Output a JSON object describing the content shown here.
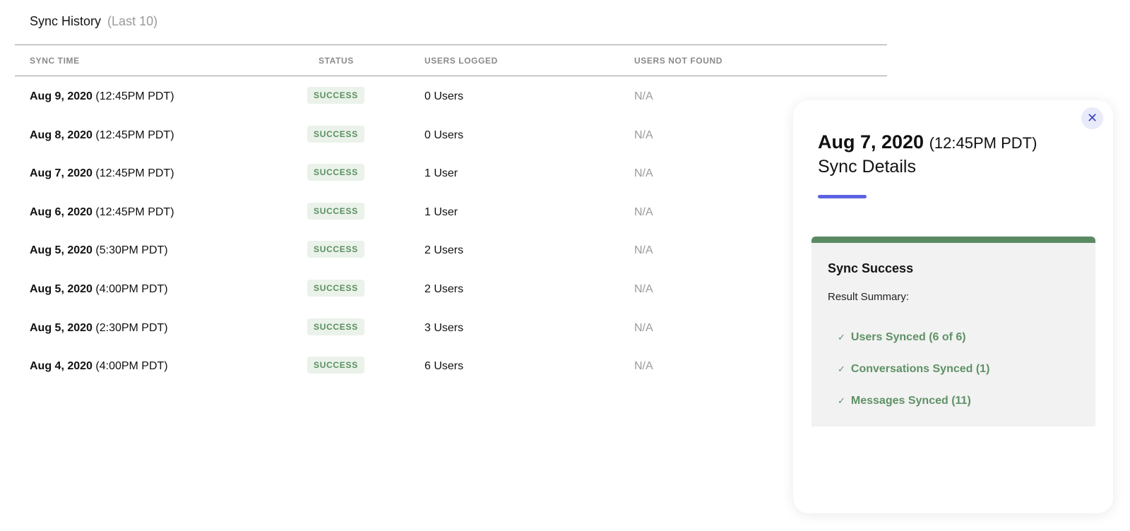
{
  "history": {
    "title": "Sync History",
    "subtitle": "(Last 10)",
    "columns": {
      "sync_time": "SYNC TIME",
      "status": "STATUS",
      "users_logged": "USERS LOGGED",
      "users_not_found": "USERS NOT FOUND"
    },
    "rows": [
      {
        "date": "Aug 9, 2020",
        "time": "(12:45PM PDT)",
        "status": "SUCCESS",
        "logged": "0 Users",
        "not_found": "N/A"
      },
      {
        "date": "Aug 8, 2020",
        "time": "(12:45PM PDT)",
        "status": "SUCCESS",
        "logged": "0 Users",
        "not_found": "N/A"
      },
      {
        "date": "Aug 7, 2020",
        "time": "(12:45PM PDT)",
        "status": "SUCCESS",
        "logged": "1 User",
        "not_found": "N/A"
      },
      {
        "date": "Aug 6, 2020",
        "time": "(12:45PM PDT)",
        "status": "SUCCESS",
        "logged": "1 User",
        "not_found": "N/A"
      },
      {
        "date": "Aug 5, 2020",
        "time": "(5:30PM PDT)",
        "status": "SUCCESS",
        "logged": "2 Users",
        "not_found": "N/A"
      },
      {
        "date": "Aug 5, 2020",
        "time": "(4:00PM PDT)",
        "status": "SUCCESS",
        "logged": "2 Users",
        "not_found": "N/A"
      },
      {
        "date": "Aug 5, 2020",
        "time": "(2:30PM PDT)",
        "status": "SUCCESS",
        "logged": "3 Users",
        "not_found": "N/A"
      },
      {
        "date": "Aug 4, 2020",
        "time": "(4:00PM PDT)",
        "status": "SUCCESS",
        "logged": "6 Users",
        "not_found": "N/A"
      }
    ]
  },
  "panel": {
    "close_icon": "close-icon",
    "close_glyph": "✕",
    "date": "Aug 7, 2020",
    "time": "(12:45PM PDT)",
    "subtitle": "Sync Details",
    "accent_color": "#5b63e3",
    "result": {
      "status_color": "#5a8a62",
      "title": "Sync Success",
      "summary_label": "Result Summary:",
      "check_glyph": "✓",
      "items": [
        "Users Synced (6 of 6)",
        "Conversations Synced (1)",
        "Messages Synced (11)"
      ]
    }
  },
  "colors": {
    "success_badge_bg": "#eaf2ea",
    "success_text": "#5a8f60"
  }
}
